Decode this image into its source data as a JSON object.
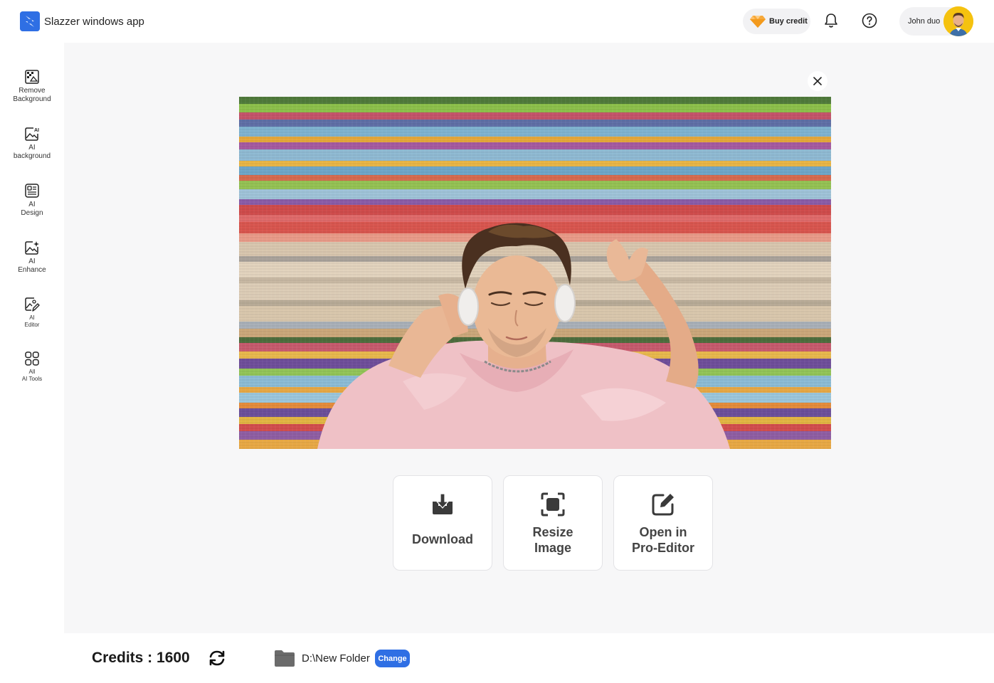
{
  "app": {
    "title": "Slazzer windows app"
  },
  "header": {
    "buy_credit_label": "Buy credit",
    "user_name": "John duo"
  },
  "sidebar": {
    "items": [
      {
        "label": "Remove\nBackground",
        "icon": "remove-background-icon"
      },
      {
        "label": "AI\nbackground",
        "icon": "ai-background-icon"
      },
      {
        "label": "AI\nDesign",
        "icon": "ai-design-icon"
      },
      {
        "label": "AI\nEnhance",
        "icon": "ai-enhance-icon"
      },
      {
        "label": "AI\nEditor",
        "icon": "ai-editor-icon"
      },
      {
        "label": "All\nAI Tools",
        "icon": "all-tools-icon"
      }
    ]
  },
  "preview": {
    "image_description_icon": "photo-preview",
    "actions": [
      {
        "label": "Download",
        "icon": "download-icon"
      },
      {
        "label": "Resize\nImage",
        "icon": "resize-icon"
      },
      {
        "label": "Open in\nPro-Editor",
        "icon": "edit-icon"
      }
    ]
  },
  "footer": {
    "credits_text": "Credits : 1600",
    "folder_path": "D:\\New Folder",
    "change_label": "Change"
  },
  "colors": {
    "accent": "#2f6fe4",
    "main_bg": "#f7f7f8",
    "chip_bg": "#f2f2f4",
    "avatar_bg": "#f5c20f"
  }
}
